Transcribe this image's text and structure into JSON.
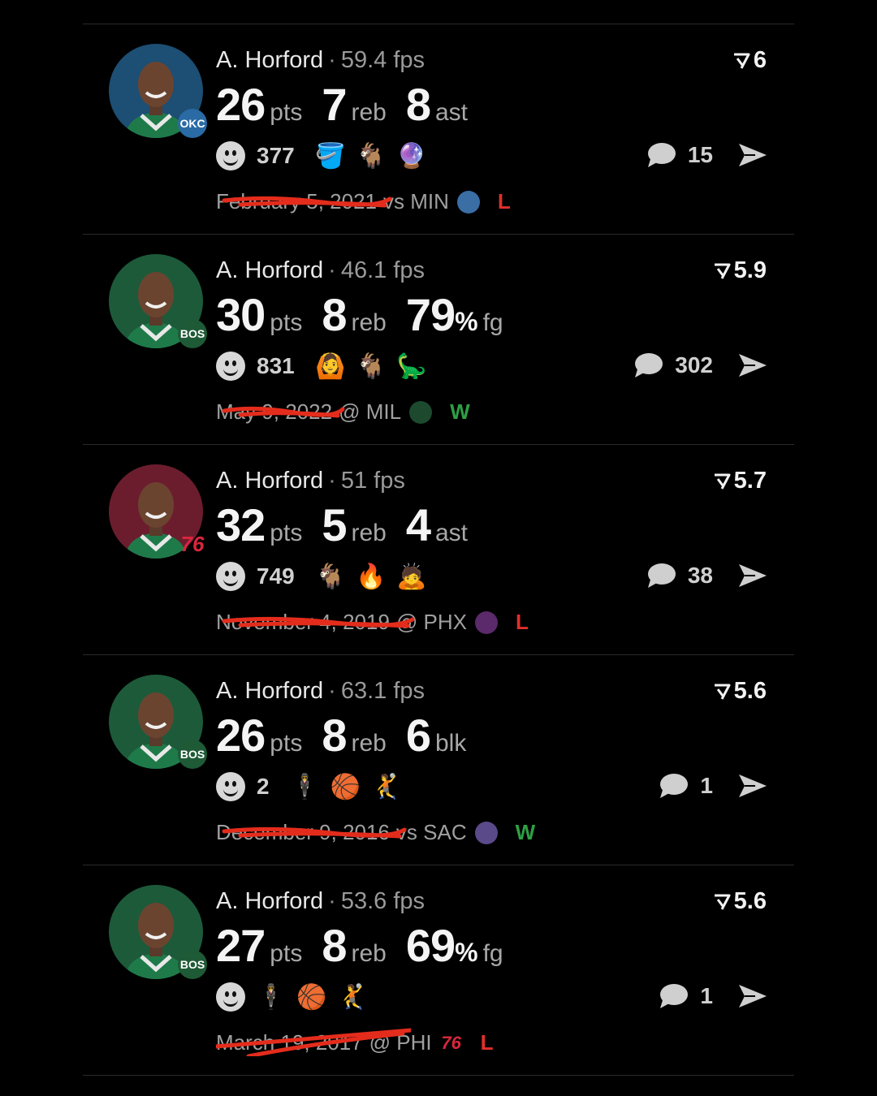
{
  "colors": {
    "win": "#2ea043",
    "loss": "#e0302a",
    "scribble": "#e42c1c"
  },
  "cards": [
    {
      "player": "A. Horford",
      "fps": "59.4 fps",
      "score": "6",
      "team": "OKC",
      "team_color": "#1d4e73",
      "stats": [
        {
          "num": "26",
          "pct": "",
          "unit": "pts"
        },
        {
          "num": "7",
          "pct": "",
          "unit": "reb"
        },
        {
          "num": "8",
          "pct": "",
          "unit": "ast"
        }
      ],
      "reactions": "377",
      "emojis": [
        "🪣",
        "🐐",
        "🔮"
      ],
      "comments": "15",
      "date": "February 5, 2021",
      "opponent": "vs MIN",
      "opp_logo": "MIN",
      "result": "L"
    },
    {
      "player": "A. Horford",
      "fps": "46.1 fps",
      "score": "5.9",
      "team": "BOS",
      "team_color": "#1d5a3a",
      "stats": [
        {
          "num": "30",
          "pct": "",
          "unit": "pts"
        },
        {
          "num": "8",
          "pct": "",
          "unit": "reb"
        },
        {
          "num": "79",
          "pct": "%",
          "unit": "fg"
        }
      ],
      "reactions": "831",
      "emojis": [
        "🙆",
        "🐐",
        "🦕"
      ],
      "comments": "302",
      "date": "May 9, 2022",
      "opponent": "@ MIL",
      "opp_logo": "MIL",
      "result": "W"
    },
    {
      "player": "A. Horford",
      "fps": "51 fps",
      "score": "5.7",
      "team": "76",
      "team_color": "#6b1d2e",
      "stats": [
        {
          "num": "32",
          "pct": "",
          "unit": "pts"
        },
        {
          "num": "5",
          "pct": "",
          "unit": "reb"
        },
        {
          "num": "4",
          "pct": "",
          "unit": "ast"
        }
      ],
      "reactions": "749",
      "emojis": [
        "🐐",
        "🔥",
        "🙇"
      ],
      "comments": "38",
      "date": "November 4, 2019",
      "opponent": "@ PHX",
      "opp_logo": "PHX",
      "result": "L"
    },
    {
      "player": "A. Horford",
      "fps": "63.1 fps",
      "score": "5.6",
      "team": "BOS",
      "team_color": "#1d5a3a",
      "stats": [
        {
          "num": "26",
          "pct": "",
          "unit": "pts"
        },
        {
          "num": "8",
          "pct": "",
          "unit": "reb"
        },
        {
          "num": "6",
          "pct": "",
          "unit": "blk"
        }
      ],
      "reactions": "2",
      "emojis": [
        "🕴",
        "🏀",
        "🤾"
      ],
      "comments": "1",
      "date": "December 9, 2016",
      "opponent": "vs SAC",
      "opp_logo": "SAC",
      "result": "W"
    },
    {
      "player": "A. Horford",
      "fps": "53.6 fps",
      "score": "5.6",
      "team": "BOS",
      "team_color": "#1d5a3a",
      "stats": [
        {
          "num": "27",
          "pct": "",
          "unit": "pts"
        },
        {
          "num": "8",
          "pct": "",
          "unit": "reb"
        },
        {
          "num": "69",
          "pct": "%",
          "unit": "fg"
        }
      ],
      "reactions": "",
      "emojis": [
        "🕴",
        "🏀",
        "🤾"
      ],
      "comments": "1",
      "date": "March 19, 2017",
      "opponent": "@ PHI",
      "opp_logo": "76",
      "result": "L"
    }
  ]
}
